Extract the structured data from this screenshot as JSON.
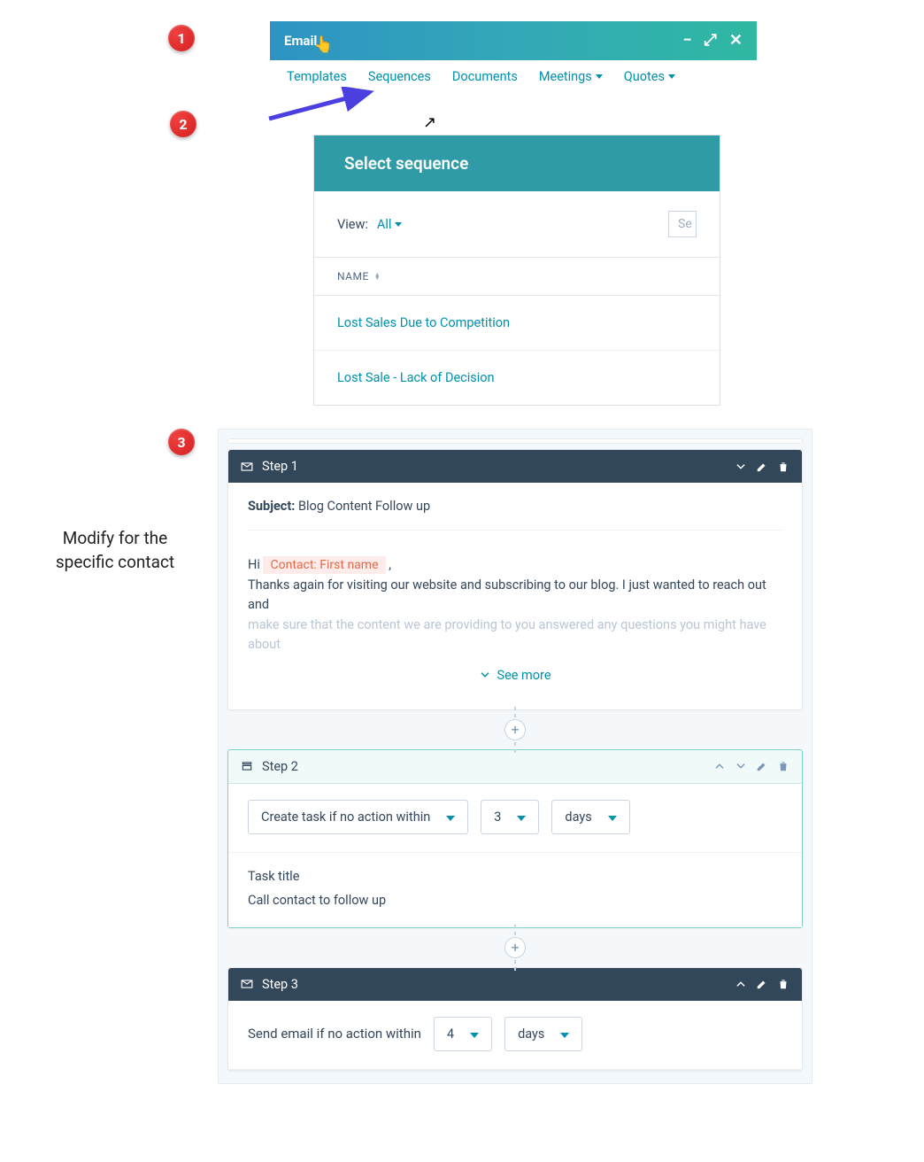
{
  "badges": {
    "b1": "1",
    "b2": "2",
    "b3": "3"
  },
  "annotation": "Modify for the specific contact",
  "email_header": {
    "title": "Email"
  },
  "tabs": [
    "Templates",
    "Sequences",
    "Documents",
    "Meetings",
    "Quotes"
  ],
  "select_sequence": {
    "title": "Select sequence",
    "view_label": "View:",
    "view_value": "All",
    "search_placeholder": "Se",
    "column": "NAME",
    "items": [
      "Lost Sales Due to Competition",
      "Lost Sale - Lack of Decision"
    ]
  },
  "editor": {
    "step1": {
      "title": "Step 1",
      "subject_label": "Subject:",
      "subject_value": "Blog Content Follow up",
      "greeting": "Hi",
      "token": "Contact: First name",
      "comma": ",",
      "line2": "Thanks again for visiting our website and subscribing to our blog.  I just wanted to reach out and",
      "line3": "make sure that the content we are providing to you answered any questions you might have about",
      "see_more": "See more"
    },
    "step2": {
      "title": "Step 2",
      "action": "Create task if no action within",
      "number": "3",
      "unit": "days",
      "task_title_label": "Task title",
      "task_title_value": "Call contact to follow up"
    },
    "step3": {
      "title": "Step 3",
      "action": "Send email if no action within",
      "number": "4",
      "unit": "days"
    },
    "add": "+"
  }
}
